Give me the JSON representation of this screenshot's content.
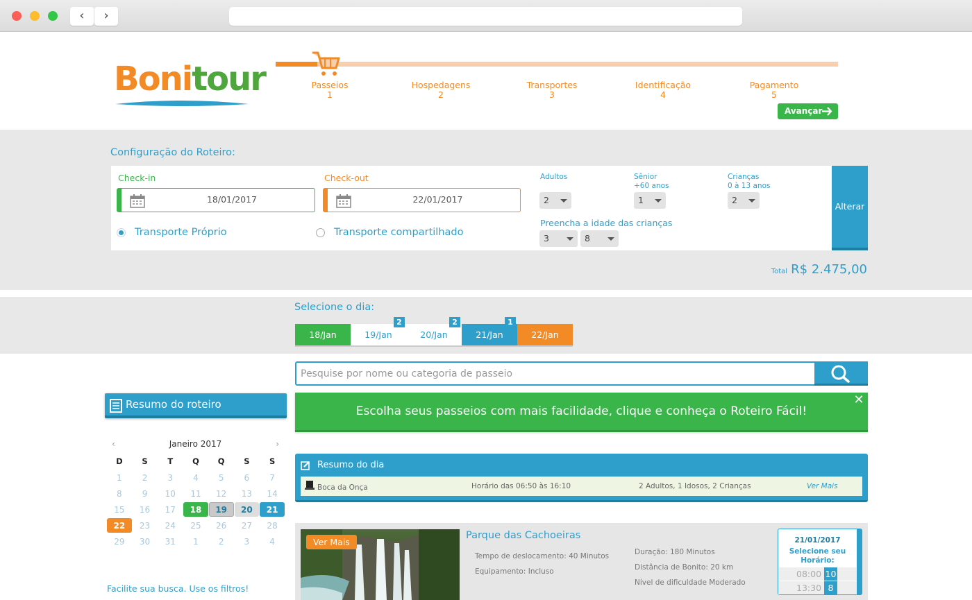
{
  "browser": {
    "back": "‹",
    "forward": "›"
  },
  "logo": {
    "part1": "Boni",
    "part2": "tour"
  },
  "steps": [
    {
      "label": "Passeios",
      "num": "1"
    },
    {
      "label": "Hospedagens",
      "num": "2"
    },
    {
      "label": "Transportes",
      "num": "3"
    },
    {
      "label": "Identificação",
      "num": "4"
    },
    {
      "label": "Pagamento",
      "num": "5"
    }
  ],
  "advance_label": "Avançar",
  "config": {
    "title": "Configuração do Roteiro:",
    "checkin_label": "Check-in",
    "checkin_value": "18/01/2017",
    "checkout_label": "Check-out",
    "checkout_value": "22/01/2017",
    "transport_own": "Transporte Próprio",
    "transport_shared": "Transporte compartilhado",
    "adults_label": "Adultos",
    "adults_value": "2",
    "senior_label1": "Sênior",
    "senior_label2": "+60 anos",
    "senior_value": "1",
    "children_label1": "Crianças",
    "children_label2": "0 à 13 anos",
    "children_value": "2",
    "children_ages_label": "Preencha a idade das crianças",
    "child_age_1": "3",
    "child_age_2": "8",
    "alter_label": "Alterar",
    "total_label": "Total",
    "total_value": "R$ 2.475,00"
  },
  "days": {
    "title": "Selecione o dia:",
    "tabs": [
      {
        "label": "18/Jan",
        "badge": ""
      },
      {
        "label": "19/Jan",
        "badge": "2"
      },
      {
        "label": "20/Jan",
        "badge": "2"
      },
      {
        "label": "21/Jan",
        "badge": "1"
      },
      {
        "label": "22/Jan",
        "badge": ""
      }
    ]
  },
  "search": {
    "placeholder": "Pesquise por nome ou categoria de passeio"
  },
  "resumo_roteiro": "Resumo do roteiro",
  "banner": {
    "text": "Escolha seus passeios com mais facilidade, clique e conheça o Roteiro Fácil!",
    "close": "✕"
  },
  "calendar": {
    "month": "Janeiro 2017",
    "prev": "‹",
    "next": "›",
    "weekdays": [
      "D",
      "S",
      "T",
      "Q",
      "Q",
      "S",
      "S"
    ],
    "weeks": [
      [
        "1",
        "2",
        "3",
        "4",
        "5",
        "6",
        "7"
      ],
      [
        "8",
        "9",
        "10",
        "11",
        "12",
        "13",
        "14"
      ],
      [
        "15",
        "16",
        "17",
        "18",
        "19",
        "20",
        "21"
      ],
      [
        "22",
        "23",
        "24",
        "25",
        "26",
        "27",
        "28"
      ],
      [
        "29",
        "30",
        "31",
        "1",
        "2",
        "3",
        "4"
      ]
    ]
  },
  "filters_hint": "Facilite sua busca. Use os filtros!",
  "resumo_dia": {
    "title": "Resumo do dia",
    "tour": "Boca da Onça",
    "hours": "Horário das 06:50 às 16:10",
    "people": "2 Adultos, 1 Idosos, 2 Crianças",
    "more": "Ver Mais"
  },
  "card": {
    "more": "Ver Mais",
    "title": "Parque das Cachoeiras",
    "travel": "Tempo de deslocamento: 40 Minutos",
    "equipment": "Equipamento: Incluso",
    "duration": "Duração: 180 Minutos",
    "distance": "Distância de Bonito: 20 km",
    "difficulty": "Nível de dificuldade Moderado",
    "date": "21/01/2017",
    "select1": "Selecione seu",
    "select2": "Horário:",
    "slots": [
      {
        "time": "08:00",
        "count": "10"
      },
      {
        "time": "13:30",
        "count": "8"
      }
    ]
  },
  "colors": {
    "blue": "#2e9fcb",
    "green": "#3ab54a",
    "orange": "#f28b25"
  }
}
